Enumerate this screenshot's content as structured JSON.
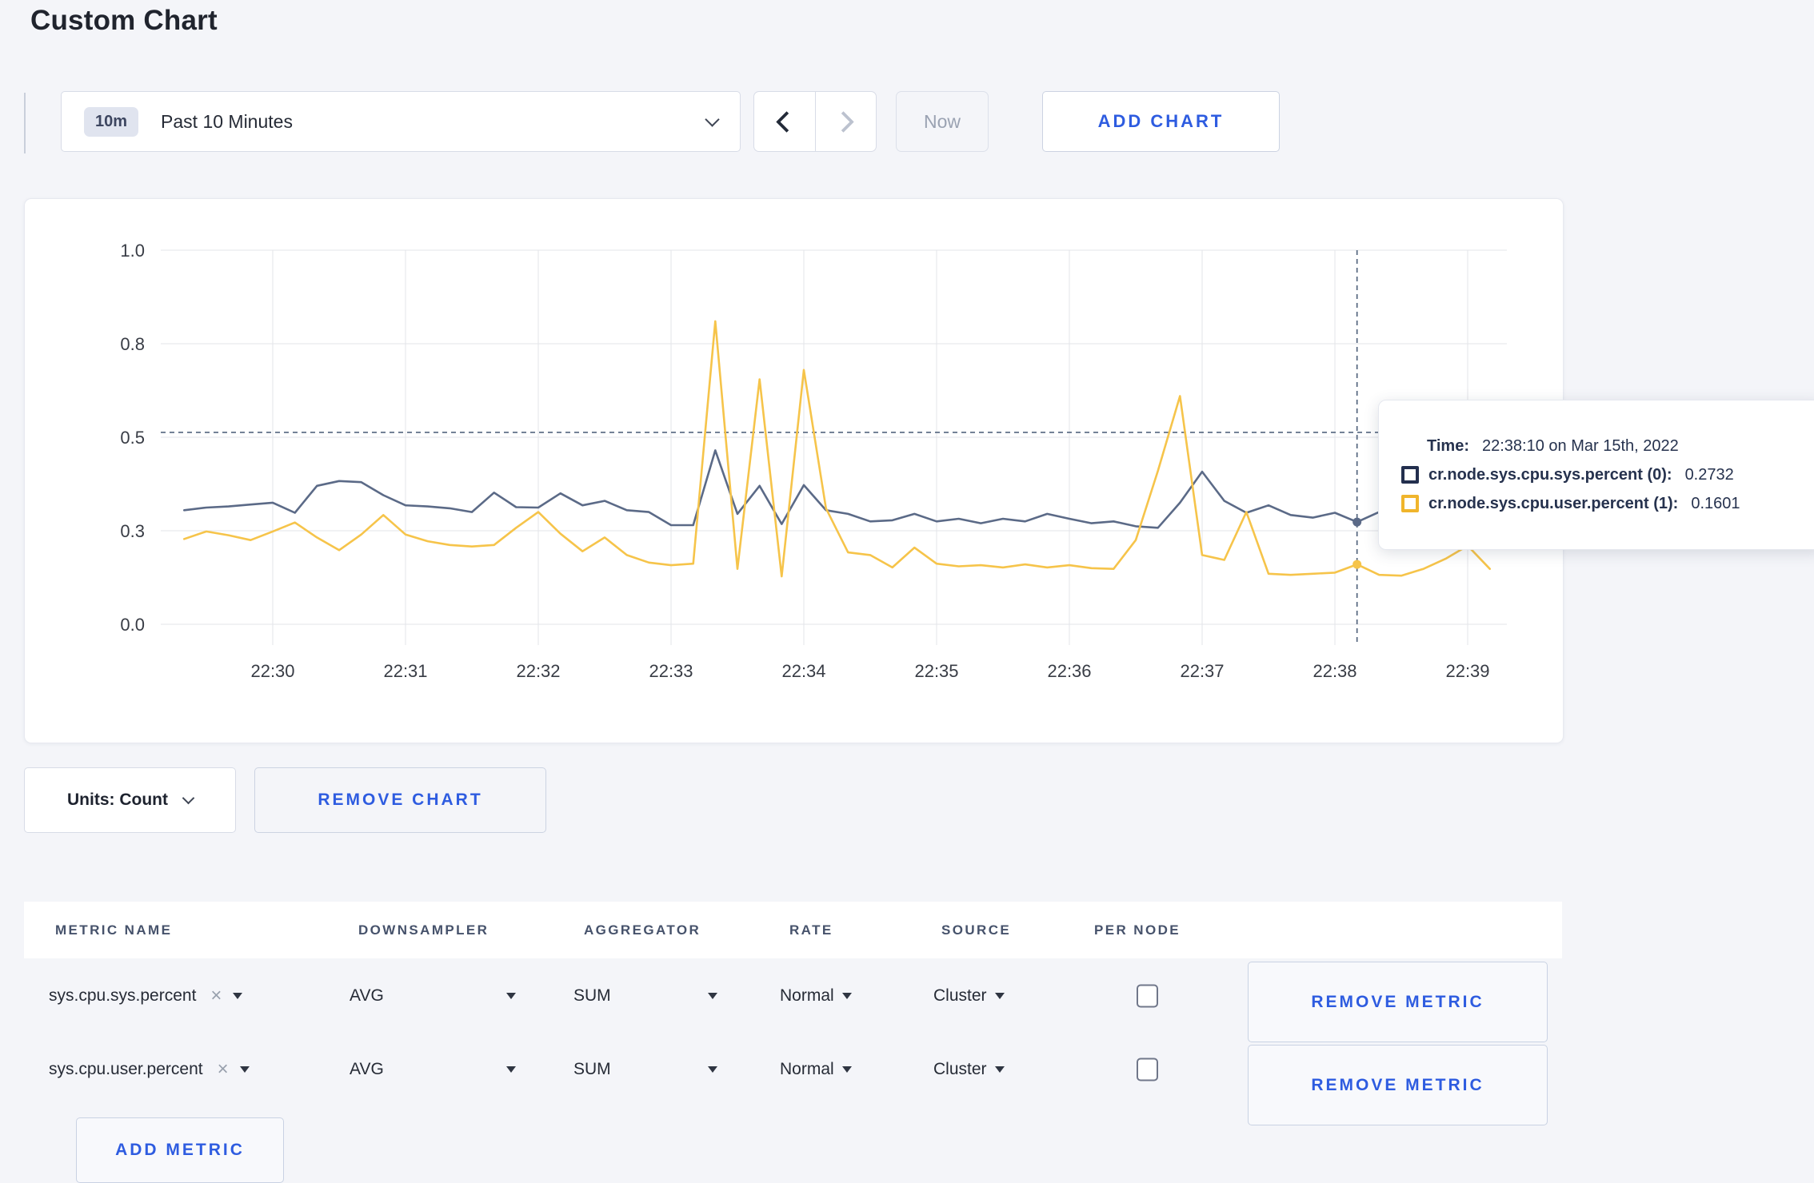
{
  "page": {
    "title": "Custom Chart"
  },
  "toolbar": {
    "time_badge": "10m",
    "time_label": "Past 10 Minutes",
    "now_label": "Now",
    "add_chart_label": "ADD CHART"
  },
  "icons": {
    "close_x": "×"
  },
  "chart_data": {
    "type": "line",
    "x_axis": {
      "tick_labels": [
        "22:30",
        "22:31",
        "22:32",
        "22:33",
        "22:34",
        "22:35",
        "22:36",
        "22:37",
        "22:38",
        "22:39"
      ],
      "time_origin": "22:30:00"
    },
    "y_axis": {
      "ylim": [
        0,
        1
      ],
      "ticks": [
        {
          "label": "1.0",
          "value": 1.0
        },
        {
          "label": "0.8",
          "value": 0.75
        },
        {
          "label": "0.5",
          "value": 0.5
        },
        {
          "label": "0.3",
          "value": 0.25
        },
        {
          "label": "0.0",
          "value": 0.0
        }
      ]
    },
    "grid": true,
    "legend_position": "none",
    "sample_start_time": "22:29:20",
    "sample_interval_seconds": 10,
    "series": [
      {
        "name": "cr.node.sys.cpu.sys.percent",
        "color": "#5b6a87",
        "values": [
          0.305,
          0.312,
          0.315,
          0.32,
          0.325,
          0.298,
          0.37,
          0.383,
          0.38,
          0.345,
          0.318,
          0.315,
          0.31,
          0.3,
          0.352,
          0.313,
          0.312,
          0.35,
          0.318,
          0.33,
          0.305,
          0.3,
          0.265,
          0.265,
          0.465,
          0.295,
          0.37,
          0.268,
          0.372,
          0.305,
          0.295,
          0.275,
          0.278,
          0.295,
          0.275,
          0.282,
          0.27,
          0.282,
          0.275,
          0.295,
          0.282,
          0.27,
          0.275,
          0.262,
          0.258,
          0.325,
          0.408,
          0.33,
          0.298,
          0.318,
          0.292,
          0.285,
          0.298,
          0.2732,
          0.3,
          0.318,
          0.3,
          0.298,
          0.308,
          0.3
        ]
      },
      {
        "name": "cr.node.sys.cpu.user.percent",
        "color": "#f6c44a",
        "values": [
          0.228,
          0.248,
          0.238,
          0.225,
          0.248,
          0.272,
          0.232,
          0.198,
          0.24,
          0.292,
          0.24,
          0.222,
          0.212,
          0.208,
          0.212,
          0.258,
          0.3,
          0.242,
          0.195,
          0.232,
          0.185,
          0.165,
          0.158,
          0.162,
          0.81,
          0.148,
          0.655,
          0.128,
          0.68,
          0.31,
          0.192,
          0.185,
          0.152,
          0.205,
          0.162,
          0.155,
          0.158,
          0.152,
          0.16,
          0.152,
          0.158,
          0.15,
          0.148,
          0.225,
          0.41,
          0.61,
          0.185,
          0.172,
          0.3,
          0.135,
          0.132,
          0.135,
          0.138,
          0.1601,
          0.132,
          0.13,
          0.148,
          0.175,
          0.21,
          0.148
        ]
      }
    ],
    "crosshair": {
      "time": "22:38:10",
      "hline_value": 0.513,
      "points": [
        {
          "series_index": 0,
          "value": 0.2732
        },
        {
          "series_index": 1,
          "value": 0.1601
        }
      ]
    }
  },
  "tooltip": {
    "time_label": "Time:",
    "time_value": "22:38:10 on Mar 15th, 2022",
    "series": [
      {
        "name": "cr.node.sys.cpu.sys.percent (0):",
        "value": "0.2732",
        "color": "#232f4e"
      },
      {
        "name": "cr.node.sys.cpu.user.percent (1):",
        "value": "0.1601",
        "color": "#f0b52c"
      }
    ]
  },
  "units": {
    "label": "Units: Count",
    "remove_chart_label": "REMOVE CHART"
  },
  "metrics_table": {
    "columns": [
      "METRIC NAME",
      "DOWNSAMPLER",
      "AGGREGATOR",
      "RATE",
      "SOURCE",
      "PER NODE"
    ],
    "rows": [
      {
        "metric": "sys.cpu.sys.percent",
        "downsampler": "AVG",
        "aggregator": "SUM",
        "rate": "Normal",
        "source": "Cluster",
        "per_node_checked": false,
        "remove_label": "REMOVE METRIC"
      },
      {
        "metric": "sys.cpu.user.percent",
        "downsampler": "AVG",
        "aggregator": "SUM",
        "rate": "Normal",
        "source": "Cluster",
        "per_node_checked": false,
        "remove_label": "REMOVE METRIC"
      }
    ],
    "add_metric_label": "ADD METRIC"
  }
}
